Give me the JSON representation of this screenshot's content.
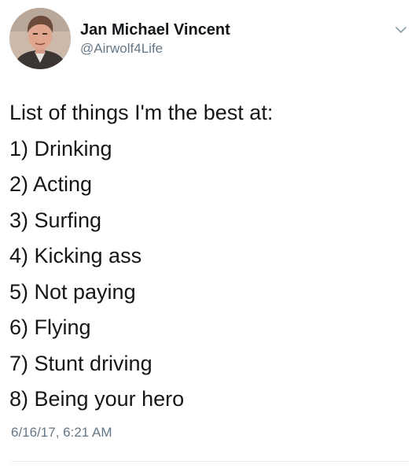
{
  "tweet": {
    "author": {
      "name": "Jan Michael Vincent",
      "handle": "@Airwolf4Life",
      "avatar_icon": "profile-photo"
    },
    "menu_icon": "chevron-down-icon",
    "lines": [
      "List of things I'm the best at:",
      "1) Drinking",
      "2) Acting",
      "3) Surfing",
      "4) Kicking ass",
      "5) Not paying",
      "6) Flying",
      "7) Stunt driving",
      "8) Being your hero"
    ],
    "timestamp": "6/16/17, 6:21 AM"
  },
  "colors": {
    "text": "#14171a",
    "secondary_text": "#657786",
    "divider": "#e6ecf0",
    "chevron": "#8899a6"
  }
}
